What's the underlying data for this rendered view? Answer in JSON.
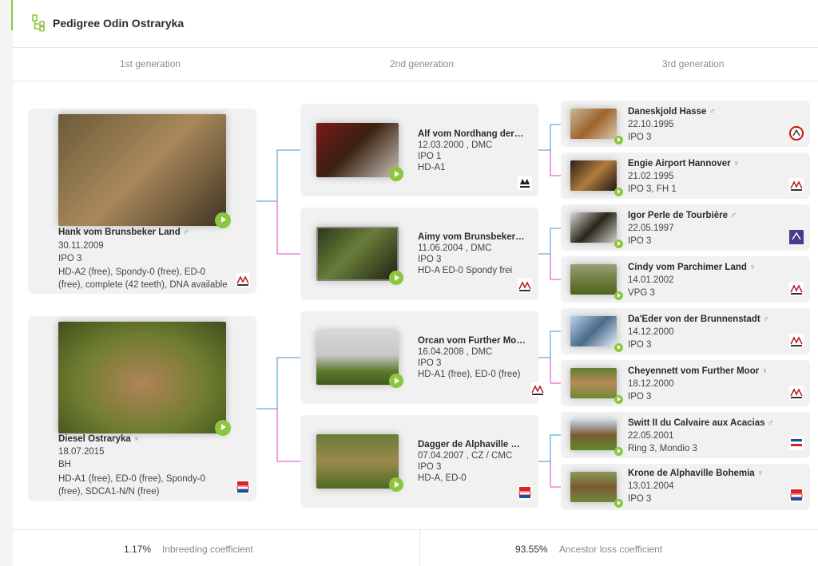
{
  "header": {
    "title": "Pedigree Odin Ostraryka",
    "icon": "pedigree-tree-icon",
    "accent": "#8cc63f"
  },
  "generations": [
    "1st generation",
    "2nd generation",
    "3rd generation"
  ],
  "colors": {
    "male_line": "#3a9ad9",
    "female_line": "#d946c6",
    "play": "#8cc63f"
  },
  "gen1": [
    {
      "name": "Hank vom Brunsbeker Land",
      "sex": "♂",
      "lines": [
        "30.11.2009",
        "IPO 3",
        "HD-A2 (free), Spondy-0 (free), ED-0 (free), complete (42 teeth), DNA available"
      ],
      "club": "dhc-logo-icon"
    },
    {
      "name": "Diesel Ostraryka",
      "sex": "♀",
      "lines": [
        "18.07.2015",
        "BH",
        "HD-A1 (free), ED-0 (free), Spondy-0 (free), SDCA1-N/N (free)"
      ],
      "club": "cz-club-logo-icon"
    }
  ],
  "gen2": [
    {
      "name": "Alf vom Nordhang der Ei...",
      "sex": "",
      "lines": [
        "12.03.2000 , DMC",
        "IPO 1",
        "HD-A1"
      ],
      "club": "kennel-logo-icon"
    },
    {
      "name": "Aimy vom Brunsbeker L...",
      "sex": "",
      "lines": [
        "11.06.2004 , DMC",
        "IPO 3",
        "HD-A ED-0 Spondy frei"
      ],
      "club": "dhc-logo-icon"
    },
    {
      "name": "Orcan vom Further Moo...",
      "sex": "",
      "lines": [
        "16.04.2008 , DMC",
        "IPO 3",
        "HD-A1 (free), ED-0 (free)"
      ],
      "club": "dhc-logo-icon"
    },
    {
      "name": "Dagger de Alphaville Bo...",
      "sex": "",
      "lines": [
        "07.04.2007 , CZ / CMC",
        "IPO 3",
        "HD-A, ED-0"
      ],
      "club": "cz-club-logo-icon"
    }
  ],
  "gen3": [
    {
      "name": "Daneskjold Hasse",
      "sex": "♂",
      "lines": [
        "22.10.1995",
        "IPO 3"
      ],
      "club": "dk-club-logo-icon"
    },
    {
      "name": "Engie Airport Hannover",
      "sex": "♀",
      "lines": [
        "21.02.1995",
        "IPO 3, FH 1"
      ],
      "club": "dhc-logo-icon"
    },
    {
      "name": "Igor Perle de Tourbière",
      "sex": "♂",
      "lines": [
        "22.05.1997",
        "IPO 3"
      ],
      "club": "fr-club-logo-icon"
    },
    {
      "name": "Cindy vom Parchimer Land",
      "sex": "♀",
      "lines": [
        "14.01.2002",
        "VPG 3"
      ],
      "club": "dhc-logo-icon"
    },
    {
      "name": "Da'Eder von der Brunnenstadt",
      "sex": "♂",
      "lines": [
        "14.12.2000",
        "IPO 3"
      ],
      "club": "dhc-logo-icon"
    },
    {
      "name": "Cheyennett vom Further Moor",
      "sex": "♀",
      "lines": [
        "18.12.2000",
        "IPO 3"
      ],
      "club": "dhc-logo-icon"
    },
    {
      "name": "Switt II du Calvaire aux Acacias",
      "sex": "♂",
      "lines": [
        "22.05.2001",
        "Ring 3, Mondio 3"
      ],
      "club": "fr-flag-logo-icon"
    },
    {
      "name": "Krone de Alphaville Bohemia",
      "sex": "♀",
      "lines": [
        "13.01.2004",
        "IPO 3"
      ],
      "club": "cz-club-logo-icon"
    }
  ],
  "footer": {
    "inbreeding_value": "1.17%",
    "inbreeding_label": "Inbreeding coefficient",
    "ancestor_value": "93.55%",
    "ancestor_label": "Ancestor loss coefficient"
  }
}
